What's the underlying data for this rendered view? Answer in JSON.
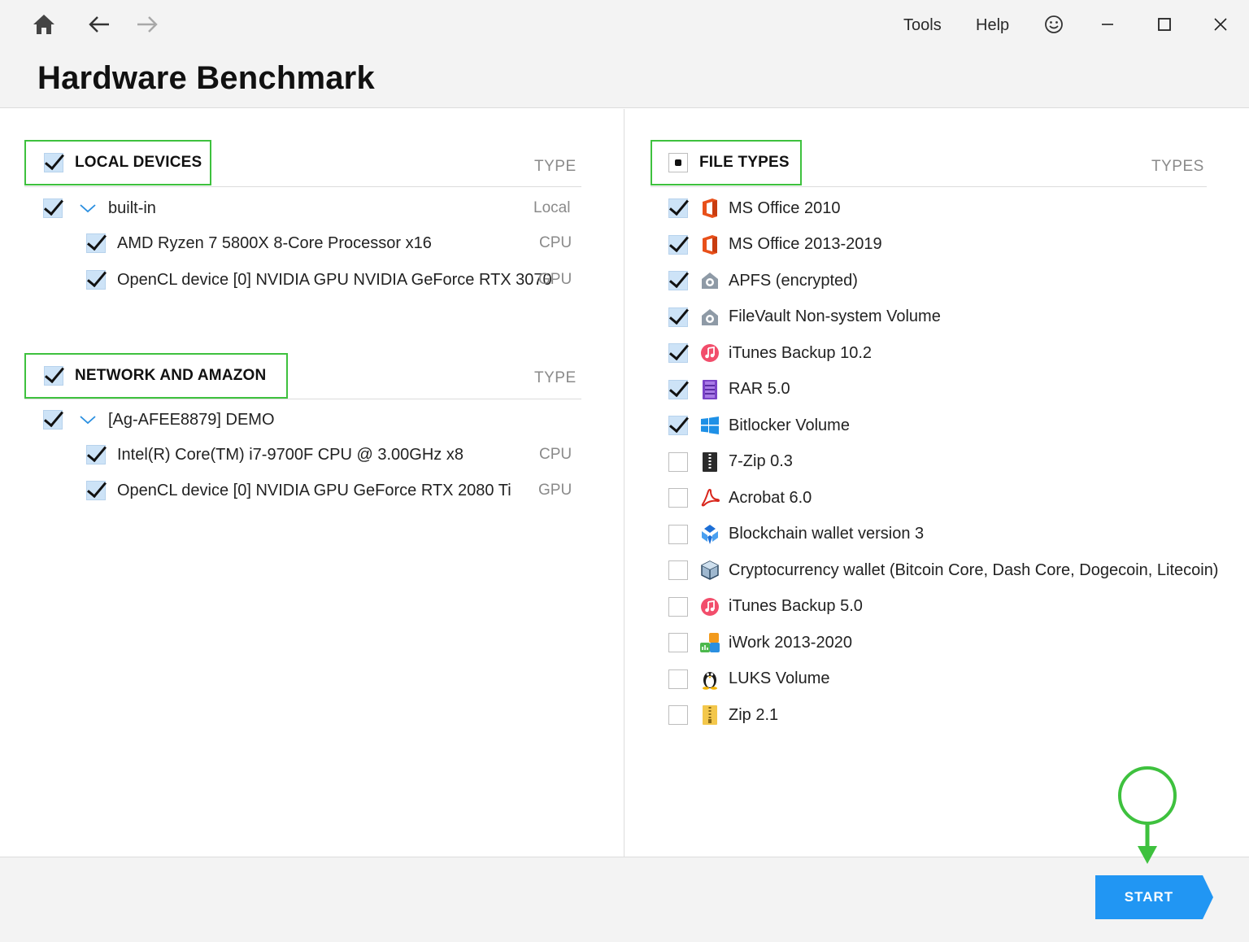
{
  "header": {
    "title": "Hardware Benchmark",
    "menu": {
      "tools": "Tools",
      "help": "Help"
    }
  },
  "local": {
    "section_label": "LOCAL DEVICES",
    "type_header": "TYPE",
    "group": {
      "label": "built-in",
      "type": "Local"
    },
    "devices": [
      {
        "label": "AMD Ryzen 7 5800X 8-Core Processor x16",
        "type": "CPU"
      },
      {
        "label": "OpenCL device [0] NVIDIA GPU NVIDIA GeForce RTX 3070",
        "type": "GPU"
      }
    ]
  },
  "network": {
    "section_label": "NETWORK AND AMAZON",
    "type_header": "TYPE",
    "group": {
      "label": "[Ag-AFEE8879] DEMO"
    },
    "devices": [
      {
        "label": "Intel(R) Core(TM) i7-9700F CPU @ 3.00GHz x8",
        "type": "CPU"
      },
      {
        "label": "OpenCL device [0] NVIDIA GPU GeForce RTX 2080 Ti",
        "type": "GPU"
      }
    ]
  },
  "file_types": {
    "section_label": "FILE TYPES",
    "type_header": "TYPES",
    "items": [
      {
        "label": "MS Office 2010",
        "checked": true,
        "icon": "ms-office-icon"
      },
      {
        "label": "MS Office 2013-2019",
        "checked": true,
        "icon": "ms-office-icon"
      },
      {
        "label": "APFS (encrypted)",
        "checked": true,
        "icon": "apfs-icon"
      },
      {
        "label": "FileVault Non-system Volume",
        "checked": true,
        "icon": "filevault-icon"
      },
      {
        "label": "iTunes Backup 10.2",
        "checked": true,
        "icon": "itunes-icon"
      },
      {
        "label": "RAR 5.0",
        "checked": true,
        "icon": "rar-icon"
      },
      {
        "label": "Bitlocker Volume",
        "checked": true,
        "icon": "windows-icon"
      },
      {
        "label": "7-Zip 0.3",
        "checked": false,
        "icon": "7zip-icon"
      },
      {
        "label": "Acrobat 6.0",
        "checked": false,
        "icon": "acrobat-icon"
      },
      {
        "label": "Blockchain wallet version 3",
        "checked": false,
        "icon": "blockchain-icon"
      },
      {
        "label": "Cryptocurrency wallet (Bitcoin Core, Dash Core, Dogecoin, Litecoin)",
        "checked": false,
        "icon": "crypto-cube-icon"
      },
      {
        "label": "iTunes Backup 5.0",
        "checked": false,
        "icon": "itunes-icon"
      },
      {
        "label": "iWork 2013-2020",
        "checked": false,
        "icon": "iwork-icon"
      },
      {
        "label": "LUKS Volume",
        "checked": false,
        "icon": "linux-penguin-icon"
      },
      {
        "label": "Zip 2.1",
        "checked": false,
        "icon": "zip-icon"
      }
    ]
  },
  "footer": {
    "start_label": "START"
  },
  "colors": {
    "accent": "#2196f3",
    "highlight": "#3ec13e",
    "check_bg": "#cde3f7"
  }
}
